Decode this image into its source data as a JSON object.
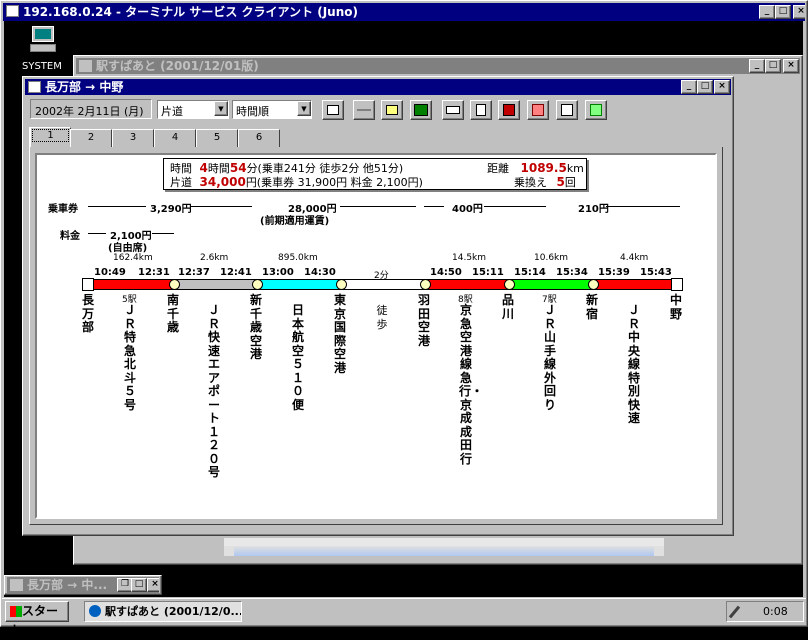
{
  "rdp": {
    "title": "192.168.0.24 - ターミナル サービス クライアント (Juno)"
  },
  "desktop": {
    "icon_label": "SYSTEM"
  },
  "bg_window": {
    "title": "駅すぱあと (2001/12/01版)"
  },
  "child": {
    "title": "長万部 → 中野"
  },
  "toolbar": {
    "date": "2002年 2月11日 (月)",
    "trip": "片道",
    "sort": "時間順"
  },
  "tabs": [
    "1",
    "2",
    "3",
    "4",
    "5",
    "6"
  ],
  "summary": {
    "time_label": "時間",
    "time_h": "4",
    "time_mid": "時間",
    "time_m": "54",
    "time_rest": "分(乗車241分 徒歩2分 他51分)",
    "dist_label": "距離",
    "dist_value": "1089.5",
    "dist_unit": "km",
    "fare_label": "片道",
    "fare_value": "34,000",
    "fare_rest": "円(乗車券 31,900円 料金 2,100円)",
    "xfer_label": "乗換え",
    "xfer_value": "5",
    "xfer_unit": "回"
  },
  "fares": {
    "ticket_label": "乗車券",
    "t1": "3,290円",
    "t2": "28,000円",
    "t2_note": "(前期適用運賃)",
    "t3": "400円",
    "t4": "210円",
    "charge_label": "料金",
    "c1": "2,100円",
    "c1_note": "(自由席)"
  },
  "distances": {
    "d1": "162.4km",
    "d2": "2.6km",
    "d3": "895.0km",
    "d4": "2分",
    "d5": "14.5km",
    "d6": "10.6km",
    "d7": "4.4km"
  },
  "times": {
    "t0": "10:49",
    "t1": "12:31",
    "t2": "12:37",
    "t3": "12:41",
    "t4": "13:00",
    "t5": "14:30",
    "t6": "14:50",
    "t7": "15:11",
    "t8": "15:14",
    "t9": "15:34",
    "t10": "15:39",
    "t11": "15:43"
  },
  "stop_counts": {
    "s1": "5駅",
    "s2": "8駅",
    "s3": "7駅"
  },
  "stations": {
    "a": "長万部",
    "b": "南千歳",
    "c": "新千歳空港",
    "d": "東京国際空港",
    "e": "羽田空港",
    "f": "品川",
    "g": "新宿",
    "h": "中野"
  },
  "lines": {
    "l1": "ＪＲ特急北斗５号",
    "l2": "ＪＲ快速エアポート１２０号",
    "l3": "日本航空５１０便",
    "l4": "徒歩",
    "l5": "京急空港線急行・京成成田行",
    "l6": "ＪＲ山手線外回り",
    "l7": "ＪＲ中央線特別快速"
  },
  "colors": {
    "ltd_express": "#ff0000",
    "rapid": "#c0c0c0",
    "air": "#00ffff",
    "walk": "#ffffff",
    "yamanote": "#00ff00",
    "chuo": "#ff0000"
  },
  "taskbar": {
    "start": "スタート",
    "task": "駅すぱあと (2001/12/0...",
    "clock": "0:08",
    "minimized": "長万部 → 中..."
  }
}
